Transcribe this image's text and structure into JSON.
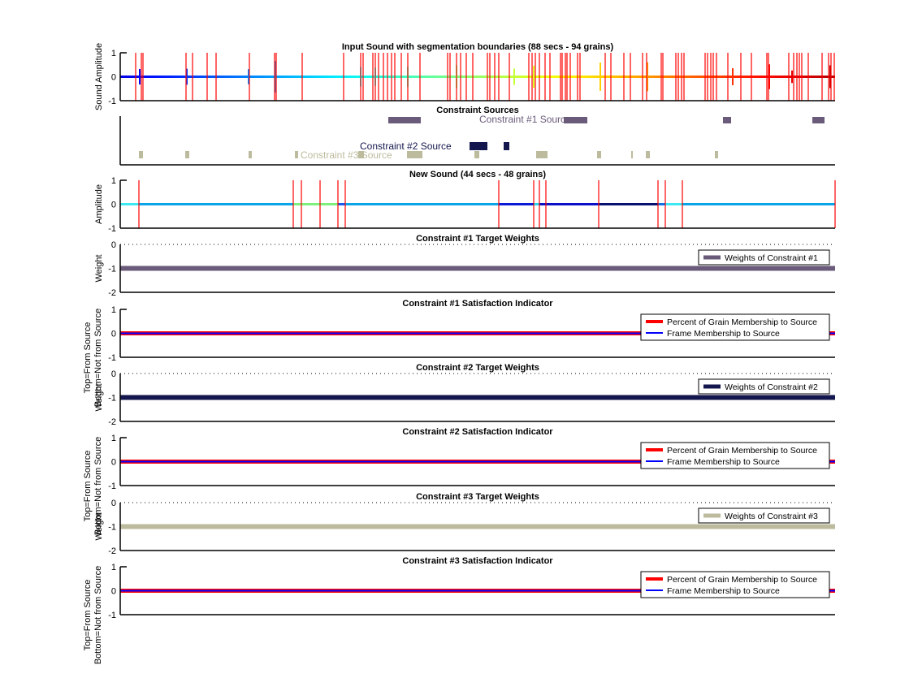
{
  "chart_data": [
    {
      "id": "input_sound",
      "type": "line",
      "title": "Input Sound with segmentation boundaries (88 secs - 94 grains)",
      "ylabel": "Sound Amplitude",
      "xlabel": "",
      "xlim_secs": [
        0,
        88
      ],
      "ylim": [
        -1,
        1
      ],
      "yticks": [
        "1",
        "0",
        "-1"
      ],
      "colormap": "jet",
      "boundary_color": "#ff0000",
      "boundaries_secs": [
        1.9,
        2.6,
        2.8,
        8.1,
        8.9,
        10.7,
        11.8,
        15.9,
        19.0,
        19.2,
        22.4,
        27.5,
        29.6,
        29.9,
        31.1,
        31.4,
        31.8,
        32.4,
        32.9,
        33.4,
        33.8,
        34.6,
        35.4,
        36.9,
        40.3,
        40.6,
        41.4,
        41.9,
        42.6,
        43.4,
        45.2,
        45.5,
        46.1,
        46.6,
        47.9,
        50.3,
        50.7,
        51.1,
        51.6,
        52.3,
        52.9,
        54.2,
        54.4,
        54.8,
        55.0,
        55.4,
        56.3,
        56.6,
        59.7,
        60.4,
        62.0,
        62.8,
        64.3,
        64.8,
        66.6,
        66.8,
        68.4,
        68.7,
        69.1,
        69.4,
        72.0,
        72.3,
        72.7,
        73.0,
        73.4,
        74.8,
        76.4,
        77.7,
        79.6,
        79.8,
        82.3,
        82.9,
        83.3,
        83.6,
        83.9,
        84.7,
        86.4,
        87.2,
        87.5,
        87.9
      ],
      "transients_secs": [
        2.4,
        8.2,
        15.8,
        19.1,
        29.6,
        31.4,
        35.4,
        41.4,
        48.5,
        50.9,
        59.1,
        64.9,
        75.4,
        79.9,
        82.7,
        87.4
      ]
    },
    {
      "id": "constraint_sources",
      "type": "bar",
      "title": "Constraint Sources",
      "xlim_secs": [
        0,
        88
      ],
      "sources": [
        {
          "name": "Constraint #1 Source",
          "color": "#6b5b7b",
          "label_at_secs": 44.2,
          "segments_secs": [
            [
              33.0,
              37.0
            ],
            [
              54.6,
              57.5
            ],
            [
              74.2,
              75.2
            ],
            [
              85.2,
              86.7
            ]
          ]
        },
        {
          "name": "Constraint #2 Source",
          "color": "#14174d",
          "label_at_secs": 29.5,
          "segments_secs": [
            [
              43.0,
              45.2
            ],
            [
              47.2,
              47.9
            ]
          ]
        },
        {
          "name": "Constraint #3 Source",
          "color": "#bdbb9d",
          "label_at_secs": 22.2,
          "segments_secs": [
            [
              2.3,
              2.8
            ],
            [
              8.0,
              8.5
            ],
            [
              15.8,
              16.2
            ],
            [
              21.5,
              21.9
            ],
            [
              29.3,
              30.0
            ],
            [
              35.3,
              37.2
            ],
            [
              43.6,
              44.2
            ],
            [
              51.2,
              52.6
            ],
            [
              58.7,
              59.2
            ],
            [
              62.9,
              63.1
            ],
            [
              64.7,
              65.2
            ],
            [
              73.2,
              73.6
            ]
          ]
        }
      ]
    },
    {
      "id": "new_sound",
      "type": "line",
      "title": "New Sound (44 secs - 48 grains)",
      "ylabel": "Amplitude",
      "xlim_secs": [
        0,
        44
      ],
      "ylim": [
        -1,
        1
      ],
      "yticks": [
        "1",
        "0",
        "-1"
      ],
      "boundary_color": "#ff0000",
      "boundaries_secs": [
        1.15,
        10.65,
        11.15,
        12.3,
        13.4,
        13.85,
        23.3,
        25.45,
        25.8,
        26.2,
        29.45,
        33.1,
        33.55,
        34.6,
        44.0
      ],
      "segments": [
        {
          "from": 0,
          "to": 1.15,
          "color": "#3de8f0"
        },
        {
          "from": 1.15,
          "to": 10.65,
          "color": "#0aa5e8"
        },
        {
          "from": 10.65,
          "to": 13.4,
          "color": "#7ef07e"
        },
        {
          "from": 13.4,
          "to": 13.85,
          "color": "#1c5af0"
        },
        {
          "from": 13.85,
          "to": 23.3,
          "color": "#0aa5e8"
        },
        {
          "from": 23.3,
          "to": 25.45,
          "color": "#0a18d8"
        },
        {
          "from": 25.45,
          "to": 25.8,
          "color": "#2ad6f0"
        },
        {
          "from": 25.8,
          "to": 29.45,
          "color": "#0a10c8"
        },
        {
          "from": 29.45,
          "to": 33.1,
          "color": "#081070"
        },
        {
          "from": 33.1,
          "to": 33.55,
          "color": "#1470e8"
        },
        {
          "from": 33.55,
          "to": 34.6,
          "color": "#3de8f0"
        },
        {
          "from": 34.6,
          "to": 44.0,
          "color": "#0aa5e8"
        }
      ]
    },
    {
      "id": "c1_weights",
      "type": "line",
      "title": "Constraint #1 Target Weights",
      "ylabel": "Weight",
      "ylim": [
        -2,
        0
      ],
      "yticks": [
        "0",
        "-1",
        "-2"
      ],
      "series": [
        {
          "name": "Weights of Constraint #1",
          "value": -1,
          "color": "#6b5b7b"
        }
      ],
      "legend": "top-right",
      "reference_line": {
        "y": 0,
        "style": "dotted"
      }
    },
    {
      "id": "c1_satisfaction",
      "type": "line",
      "title": "Constraint #1 Satisfaction Indicator",
      "ylabel": [
        "Top=From Source",
        "Bottom=Not from Source"
      ],
      "ylim": [
        -1,
        1
      ],
      "yticks": [
        "1",
        "0",
        "-1"
      ],
      "series": [
        {
          "name": "Percent of Grain Membership to Source",
          "value": 0,
          "color": "#ff0000"
        },
        {
          "name": "Frame Membership to Source",
          "value": 0,
          "color": "#0000ff"
        }
      ],
      "legend": "top-right"
    },
    {
      "id": "c2_weights",
      "type": "line",
      "title": "Constraint #2 Target Weights",
      "ylabel": "Weight",
      "ylim": [
        -2,
        0
      ],
      "yticks": [
        "0",
        "-1",
        "-2"
      ],
      "series": [
        {
          "name": "Weights of Constraint #2",
          "value": -1,
          "color": "#14174d"
        }
      ],
      "legend": "top-right",
      "reference_line": {
        "y": 0,
        "style": "dotted"
      }
    },
    {
      "id": "c2_satisfaction",
      "type": "line",
      "title": "Constraint #2 Satisfaction Indicator",
      "ylabel": [
        "Top=From Source",
        "Bottom=Not from Source"
      ],
      "ylim": [
        -1,
        1
      ],
      "yticks": [
        "1",
        "0",
        "-1"
      ],
      "series": [
        {
          "name": "Percent of Grain Membership to Source",
          "value": 0,
          "color": "#ff0000"
        },
        {
          "name": "Frame Membership to Source",
          "value": 0,
          "color": "#0000ff"
        }
      ],
      "legend": "top-right"
    },
    {
      "id": "c3_weights",
      "type": "line",
      "title": "Constraint #3 Target Weights",
      "ylabel": "Weight",
      "ylim": [
        -2,
        0
      ],
      "yticks": [
        "0",
        "-1",
        "-2"
      ],
      "series": [
        {
          "name": "Weights of Constraint #3",
          "value": -1,
          "color": "#bdbb9d"
        }
      ],
      "legend": "top-right",
      "reference_line": {
        "y": 0,
        "style": "dotted"
      }
    },
    {
      "id": "c3_satisfaction",
      "type": "line",
      "title": "Constraint #3 Satisfaction Indicator",
      "ylabel": [
        "Top=From Source",
        "Bottom=Not from Source"
      ],
      "ylim": [
        -1,
        1
      ],
      "yticks": [
        "1",
        "0",
        "-1"
      ],
      "series": [
        {
          "name": "Percent of Grain Membership to Source",
          "value": 0,
          "color": "#ff0000"
        },
        {
          "name": "Frame Membership to Source",
          "value": 0,
          "color": "#0000ff"
        }
      ],
      "legend": "top-right"
    }
  ]
}
